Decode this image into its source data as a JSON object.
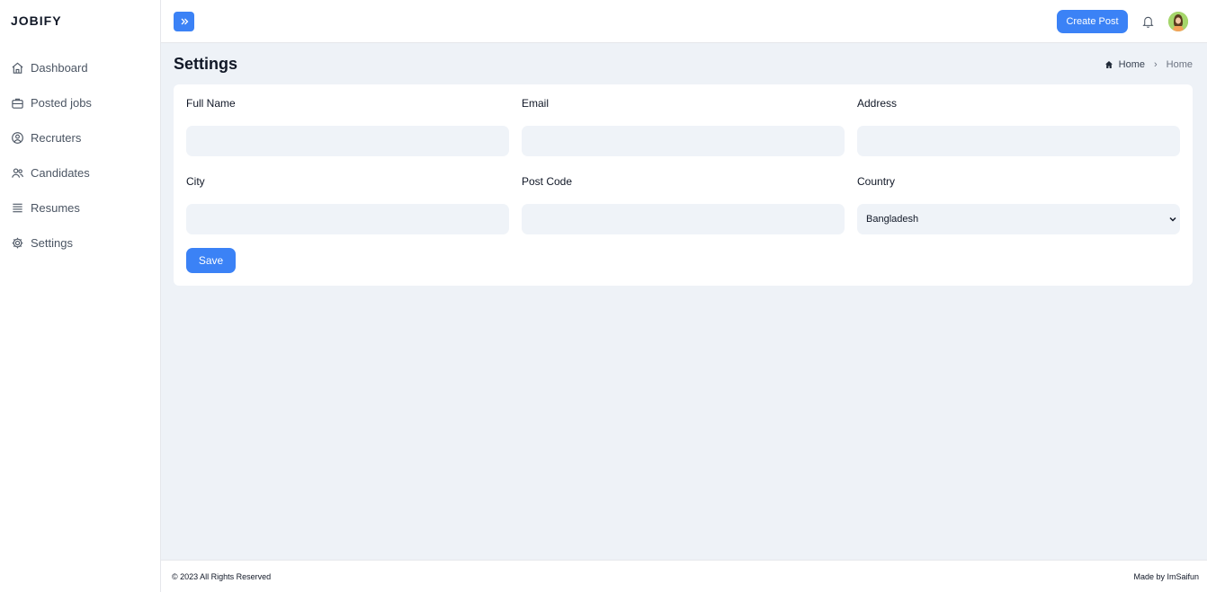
{
  "app": {
    "brand": "JOBIFY"
  },
  "sidebar": {
    "items": [
      {
        "label": "Dashboard",
        "icon": "home-icon"
      },
      {
        "label": "Posted jobs",
        "icon": "briefcase-icon"
      },
      {
        "label": "Recruters",
        "icon": "user-circle-icon"
      },
      {
        "label": "Candidates",
        "icon": "users-icon"
      },
      {
        "label": "Resumes",
        "icon": "list-icon"
      },
      {
        "label": "Settings",
        "icon": "gear-icon"
      }
    ]
  },
  "header": {
    "create_post_label": "Create Post",
    "toggle_icon": "double-chevron-right-icon",
    "notification_icon": "bell-icon",
    "accent_color": "#3b82f6"
  },
  "page": {
    "title": "Settings",
    "breadcrumb": {
      "home": "Home",
      "current": "Home"
    }
  },
  "form": {
    "full_name_label": "Full Name",
    "full_name_value": "",
    "email_label": "Email",
    "email_value": "",
    "address_label": "Address",
    "address_value": "",
    "city_label": "City",
    "city_value": "",
    "post_code_label": "Post Code",
    "post_code_value": "",
    "country_label": "Country",
    "country_value": "Bangladesh",
    "save_label": "Save"
  },
  "footer": {
    "copyright": "© 2023 All Rights Reserved",
    "credit": "Made by ImSaifun"
  }
}
